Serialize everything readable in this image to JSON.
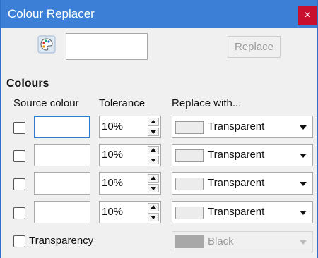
{
  "window": {
    "title": "Colour Replacer",
    "close_glyph": "×"
  },
  "toolbar": {
    "picker_icon": "colour-palette-icon",
    "replace_label_pre": "",
    "replace_label_mnemonic": "R",
    "replace_label_post": "eplace"
  },
  "colours": {
    "section_label": "Colours",
    "headers": {
      "source": "Source colour",
      "tolerance": "Tolerance",
      "replace_with": "Replace with..."
    },
    "rows": [
      {
        "tolerance": "10%",
        "replace_with": "Transparent"
      },
      {
        "tolerance": "10%",
        "replace_with": "Transparent"
      },
      {
        "tolerance": "10%",
        "replace_with": "Transparent"
      },
      {
        "tolerance": "10%",
        "replace_with": "Transparent"
      }
    ]
  },
  "transparency": {
    "label_pre": "T",
    "label_mnemonic": "r",
    "label_post": "ansparency",
    "colour": "Black"
  },
  "colors": {
    "title_bar": "#3c7fd6",
    "close_button": "#c8102e",
    "focus_border": "#2f7bd0"
  }
}
